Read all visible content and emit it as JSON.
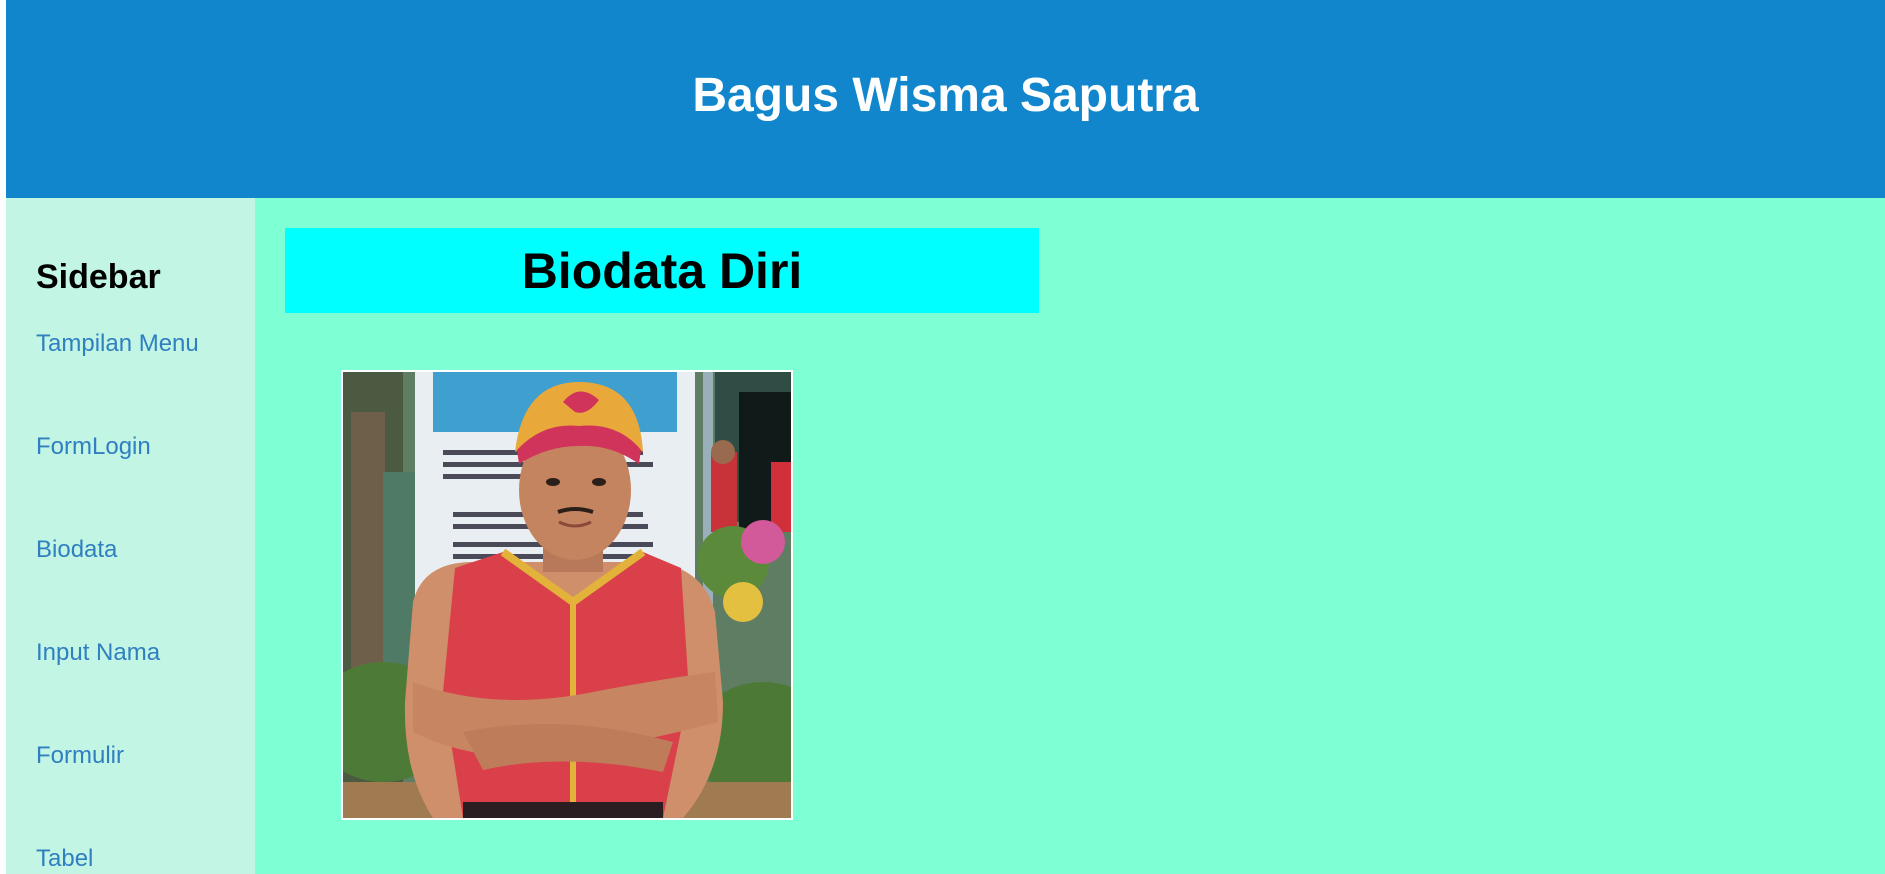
{
  "header": {
    "title": "Bagus Wisma Saputra"
  },
  "sidebar": {
    "heading": "Sidebar",
    "items": [
      {
        "label": "Tampilan Menu"
      },
      {
        "label": "FormLogin"
      },
      {
        "label": "Biodata"
      },
      {
        "label": "Input Nama"
      },
      {
        "label": "Formulir"
      },
      {
        "label": "Tabel"
      }
    ]
  },
  "main": {
    "title": "Biodata Diri",
    "photo_icon": "profile-photo"
  },
  "colors": {
    "header_bg": "#1186cc",
    "sidebar_bg": "#c2f5e4",
    "content_bg": "#7fffd4",
    "title_bg": "#00ffff",
    "link": "#2f7fc1"
  }
}
